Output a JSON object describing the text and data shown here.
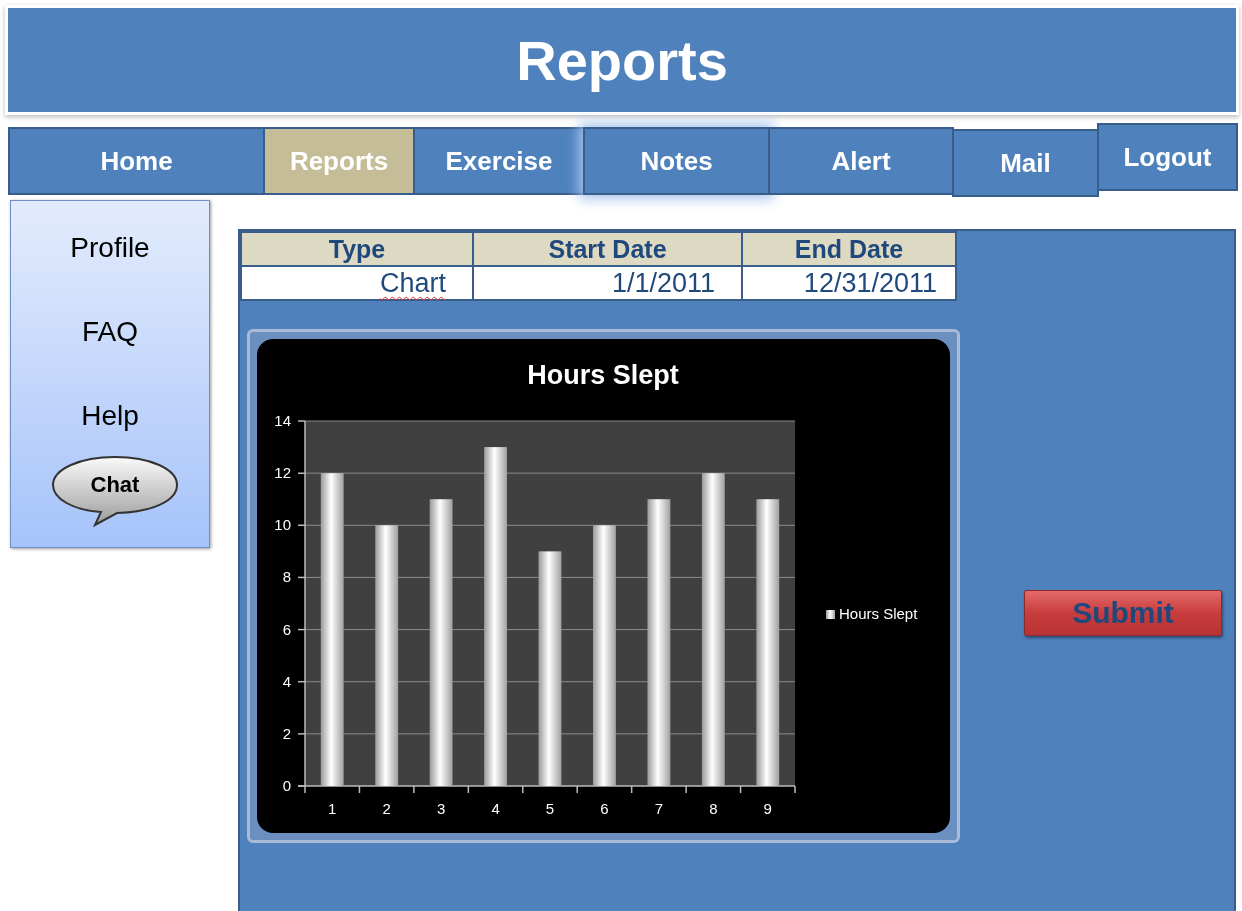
{
  "header": {
    "title": "Reports"
  },
  "nav": [
    {
      "label": "Home",
      "selected": false
    },
    {
      "label": "Reports",
      "selected": true
    },
    {
      "label": "Exercise",
      "selected": false
    },
    {
      "label": "Notes",
      "selected": false
    },
    {
      "label": "Alert",
      "selected": false
    },
    {
      "label": "Mail",
      "selected": false
    },
    {
      "label": "Logout",
      "selected": false
    }
  ],
  "sidebar": {
    "items": [
      {
        "label": "Profile"
      },
      {
        "label": "FAQ"
      },
      {
        "label": "Help"
      }
    ],
    "chat_button": "Chat"
  },
  "report_table": {
    "columns": [
      "Type",
      "Start Date",
      "End Date"
    ],
    "rows": [
      [
        "Chart",
        "1/1/2011",
        "12/31/2011"
      ]
    ]
  },
  "report_chart": {
    "chart_data": {
      "type": "bar",
      "title": "Hours Slept",
      "categories": [
        "1",
        "2",
        "3",
        "4",
        "5",
        "6",
        "7",
        "8",
        "9"
      ],
      "series": [
        {
          "name": "Hours Slept",
          "color": "#ffffff",
          "values": [
            12,
            10,
            11,
            13,
            9,
            10,
            11,
            12,
            11
          ]
        }
      ],
      "grid": true,
      "ylim": [
        0,
        14
      ],
      "yticks": [
        0,
        2,
        4,
        6,
        8,
        10,
        12,
        14
      ]
    }
  },
  "submit_button": "Submit"
}
